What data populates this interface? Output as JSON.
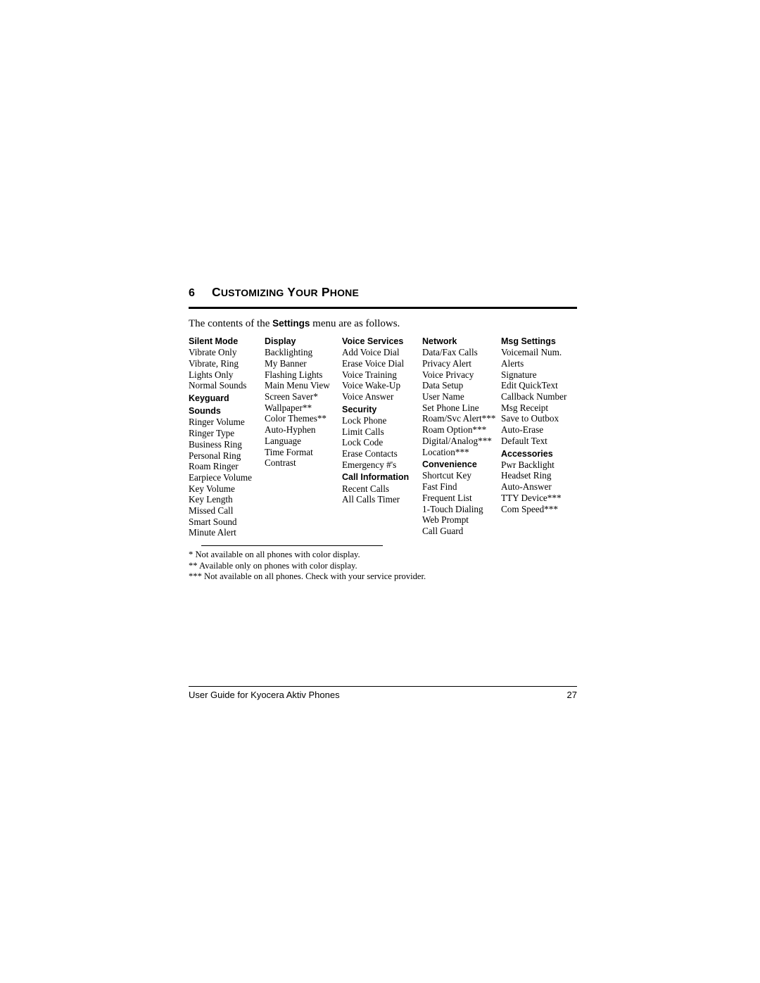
{
  "chapter": {
    "number": "6",
    "title_first": "C",
    "title_rest": "USTOMIZING",
    "title_second_first": "Y",
    "title_second_rest": "OUR",
    "title_third_first": "P",
    "title_third_rest": "HONE",
    "title_plain": "6 CUSTOMIZING YOUR PHONE"
  },
  "intro": {
    "before": "The contents of the ",
    "bold": "Settings",
    "after": " menu are as follows."
  },
  "columns": [
    {
      "groups": [
        {
          "heading": "Silent Mode",
          "items": [
            "Vibrate Only",
            "Vibrate, Ring",
            "Lights Only",
            "Normal Sounds"
          ]
        },
        {
          "heading": "Keyguard",
          "items": []
        },
        {
          "heading": "Sounds",
          "items": [
            "Ringer Volume",
            "Ringer Type",
            "Business Ring",
            "Personal Ring",
            "Roam Ringer",
            "Earpiece Volume",
            "Key Volume",
            "Key Length",
            "Missed Call",
            "Smart Sound",
            "Minute Alert"
          ]
        }
      ]
    },
    {
      "groups": [
        {
          "heading": "Display",
          "items": [
            "Backlighting",
            "My Banner",
            "Flashing Lights",
            "Main Menu View",
            "Screen Saver*",
            "Wallpaper**",
            "Color Themes**",
            "Auto-Hyphen",
            "Language",
            "Time Format",
            "Contrast"
          ]
        }
      ]
    },
    {
      "groups": [
        {
          "heading": "Voice Services",
          "items": [
            "Add Voice Dial",
            "Erase Voice Dial",
            "Voice Training",
            "Voice Wake-Up",
            "Voice Answer"
          ]
        },
        {
          "heading": "Security",
          "items": [
            "Lock Phone",
            "Limit Calls",
            "Lock Code",
            "Erase Contacts",
            "Emergency #'s"
          ]
        },
        {
          "heading": "Call Information",
          "items": [
            "Recent Calls",
            "All Calls Timer"
          ]
        }
      ]
    },
    {
      "groups": [
        {
          "heading": "Network",
          "items": [
            "Data/Fax Calls",
            "Privacy Alert",
            "Voice Privacy",
            "Data Setup",
            "User Name",
            "Set Phone Line",
            "Roam/Svc Alert***",
            "Roam Option***",
            "Digital/Analog***",
            "Location***"
          ]
        },
        {
          "heading": "Convenience",
          "items": [
            "Shortcut Key",
            "Fast Find",
            "Frequent List",
            "1-Touch Dialing",
            "Web Prompt",
            "Call Guard"
          ]
        }
      ]
    },
    {
      "groups": [
        {
          "heading": "Msg Settings",
          "items": [
            "Voicemail Num.",
            "Alerts",
            "Signature",
            "Edit QuickText",
            "Callback Number",
            "Msg Receipt",
            "Save to Outbox",
            "Auto-Erase",
            "Default Text"
          ]
        },
        {
          "heading": "Accessories",
          "items": [
            "Pwr Backlight",
            "Headset Ring",
            "Auto-Answer",
            "TTY Device***",
            "Com Speed***"
          ]
        }
      ]
    }
  ],
  "footnotes": [
    "* Not available on all phones with color display.",
    "** Available only on phones with color display.",
    "*** Not available on all phones. Check with your service provider."
  ],
  "footer": {
    "left": "User Guide for Kyocera Aktiv Phones",
    "right": "27"
  }
}
